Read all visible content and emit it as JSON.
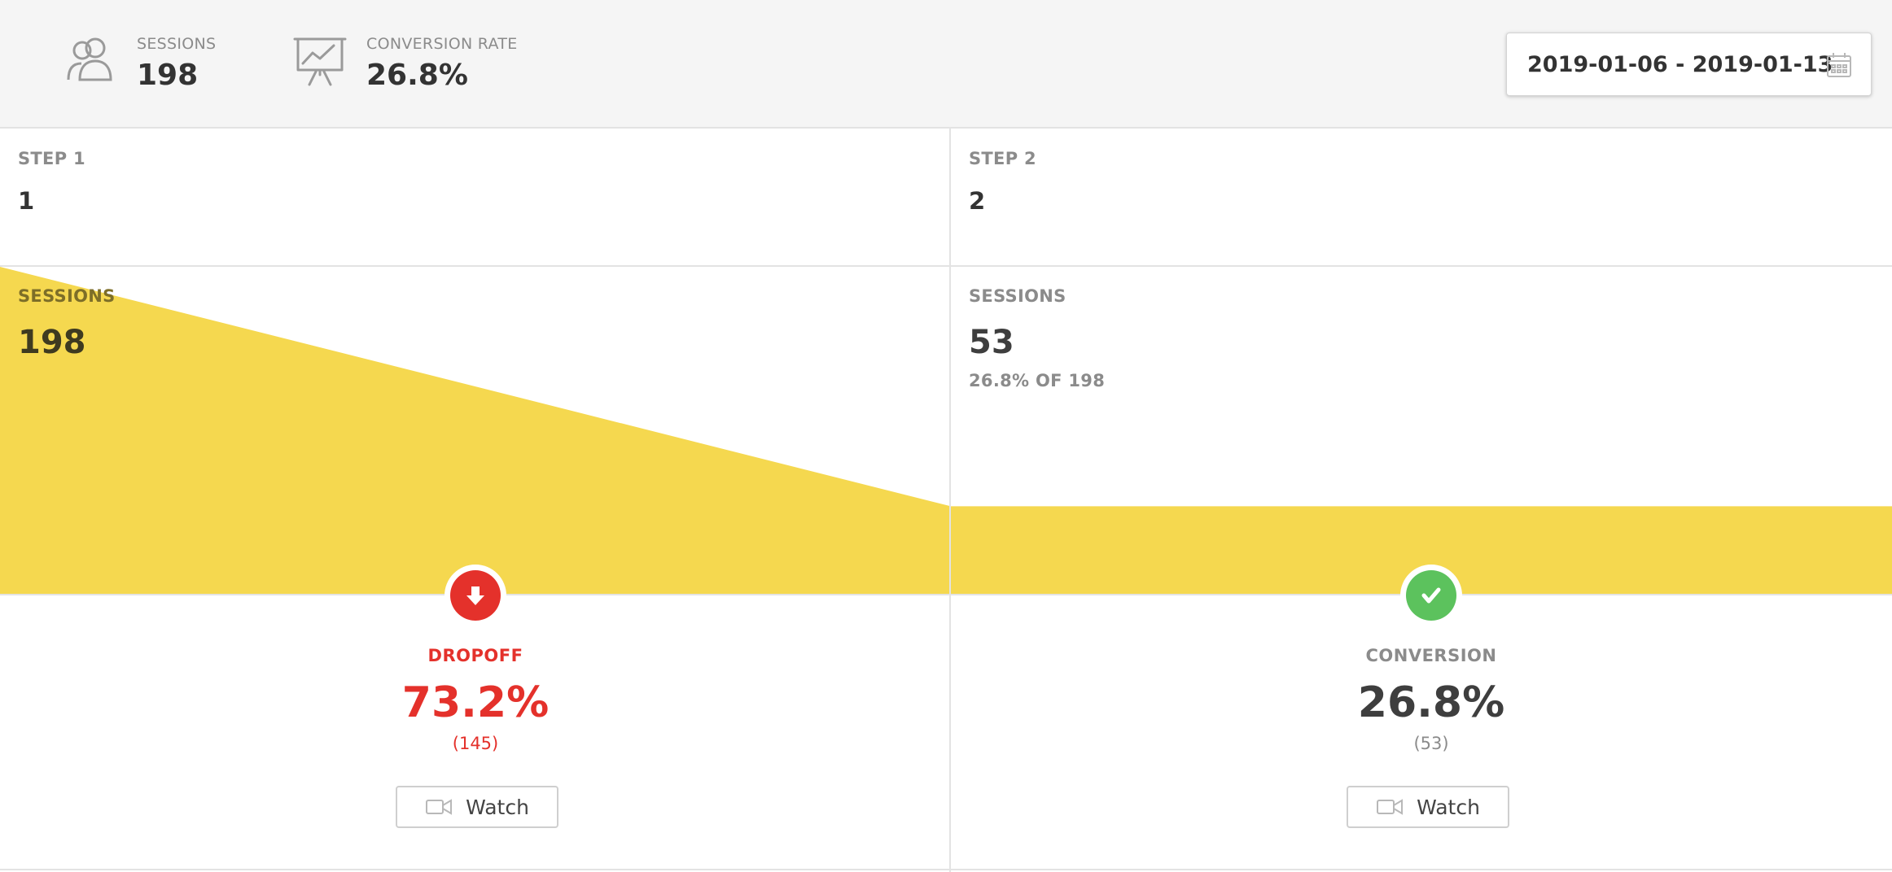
{
  "header": {
    "sessions": {
      "label": "SESSIONS",
      "value": "198",
      "icon": "users-icon"
    },
    "conversion_rate": {
      "label": "CONVERSION RATE",
      "value": "26.8%",
      "icon": "presentation-chart-icon"
    },
    "date_range": {
      "value": "2019-01-06 - 2019-01-13",
      "icon": "calendar-icon"
    }
  },
  "steps": [
    {
      "title": "STEP 1",
      "name": "1",
      "sessions_label": "SESSIONS",
      "sessions_value": "198",
      "metric": {
        "label": "DROPOFF",
        "value": "73.2%",
        "count": "(145)",
        "icon": "arrow-down-icon"
      },
      "watch_label": "Watch"
    },
    {
      "title": "STEP 2",
      "name": "2",
      "sessions_label": "SESSIONS",
      "sessions_value": "53",
      "sessions_sub": "26.8% OF 198",
      "metric": {
        "label": "CONVERSION",
        "value": "26.8%",
        "count": "(53)",
        "icon": "checkmark-icon"
      },
      "watch_label": "Watch"
    }
  ],
  "funnel": {
    "step_sessions": [
      198,
      53
    ],
    "max_sessions": 198
  },
  "colors": {
    "funnel_fill": "#f5d84f",
    "dropoff": "#e4312b",
    "conversion": "#5cc25d",
    "header_bg": "#f5f5f5"
  }
}
